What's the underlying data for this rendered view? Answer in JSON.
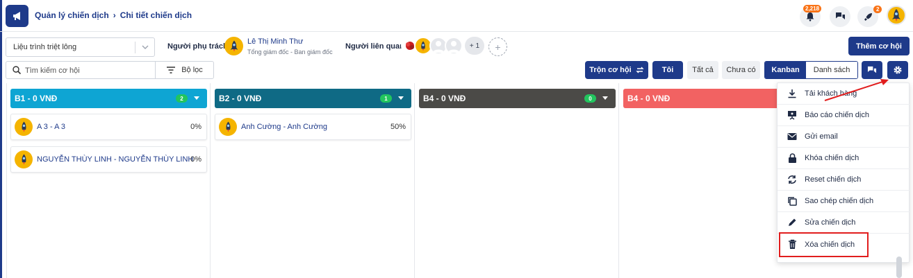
{
  "breadcrumb": {
    "parent": "Quản lý chiến dịch",
    "current": "Chi tiết chiến dịch"
  },
  "header": {
    "notification_count": "2,218",
    "rocket_count": "2"
  },
  "pipeline_select": {
    "value": "Liệu trình triệt lông"
  },
  "owner": {
    "label": "Người phụ trách",
    "name": "Lê Thị Minh Thư",
    "title": "Tổng giám đốc - Ban giám đốc"
  },
  "related": {
    "label": "Người liên quan",
    "more": "+ 1",
    "add": "+"
  },
  "actions": {
    "add_opportunity": "Thêm cơ hội",
    "merge_opportunity": "Trộn cơ hội",
    "mine": "Tôi",
    "all": "Tất cả",
    "unassigned": "Chưa có",
    "kanban": "Kanban",
    "list": "Danh sách"
  },
  "search": {
    "placeholder": "Tìm kiếm cơ hội",
    "filter_label": "Bộ lọc"
  },
  "columns": [
    {
      "title": "B1 - 0 VNĐ",
      "count": "2",
      "color": "#0ea5d3",
      "cards": [
        {
          "name": "A 3 - A 3",
          "percent": "0%"
        },
        {
          "name": "NGUYỄN THÙY LINH - NGUYỄN THÙY LINH",
          "percent": "0%"
        }
      ]
    },
    {
      "title": "B2 - 0 VNĐ",
      "count": "1",
      "color": "#0f6a85",
      "cards": [
        {
          "name": "Anh Cường - Anh Cường",
          "percent": "50%"
        }
      ]
    },
    {
      "title": "B4 - 0 VNĐ",
      "count": "0",
      "color": "#4b4a47",
      "cards": []
    },
    {
      "title": "B4 - 0 VNĐ",
      "count": "",
      "color": "#f26262",
      "cards": []
    }
  ],
  "menu": [
    {
      "label": "Tải khách hàng",
      "icon": "download-icon"
    },
    {
      "label": "Báo cáo chiến dịch",
      "icon": "presentation-icon"
    },
    {
      "label": "Gửi email",
      "icon": "email-icon"
    },
    {
      "label": "Khóa chiến dịch",
      "icon": "lock-icon"
    },
    {
      "label": "Reset chiến dịch",
      "icon": "reset-icon"
    },
    {
      "label": "Sao chép chiến dịch",
      "icon": "copy-icon"
    },
    {
      "label": "Sửa chiến dịch",
      "icon": "pencil-icon"
    },
    {
      "label": "Xóa chiến dịch",
      "icon": "trash-icon"
    }
  ],
  "colors": {
    "brand": "#1e3a8a",
    "badge": "#f97316",
    "highlight": "#e11d1d"
  }
}
